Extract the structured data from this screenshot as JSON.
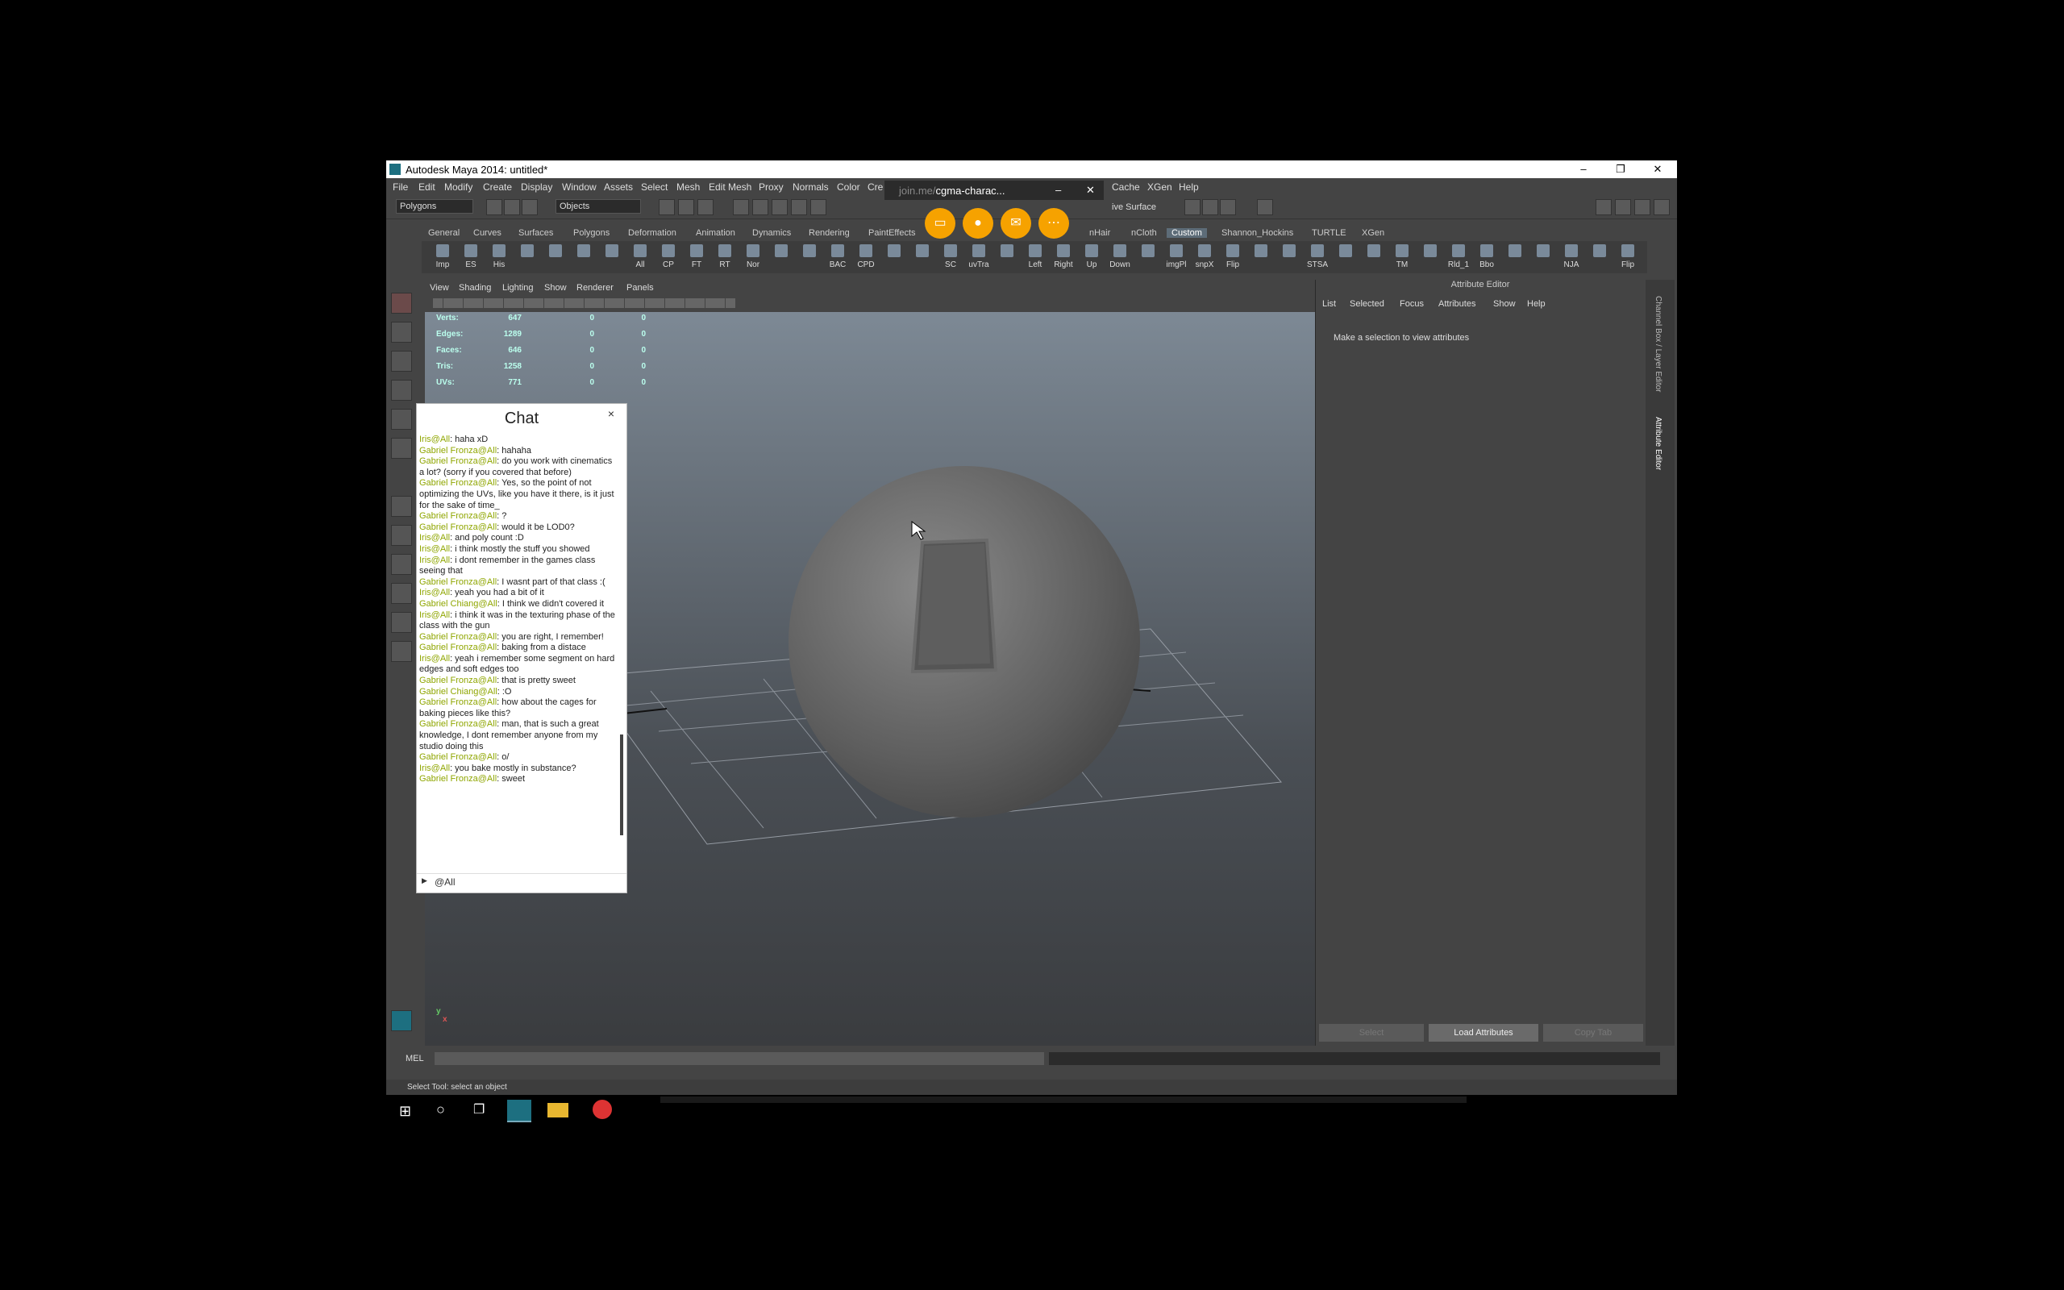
{
  "window": {
    "title": "Autodesk Maya 2014: untitled*",
    "minimize": "–",
    "maximize": "❐",
    "close": "✕"
  },
  "menubar": [
    "File",
    "Edit",
    "Modify",
    "Create",
    "Display",
    "Window",
    "Assets",
    "Select",
    "Mesh",
    "Edit Mesh",
    "Proxy",
    "Normals",
    "Color",
    "Cre",
    "Cache",
    "XGen",
    "Help"
  ],
  "statusline": {
    "menuset": "Polygons",
    "selmode": "Objects",
    "live": "ive Surface"
  },
  "shelf_tabs": [
    "General",
    "Curves",
    "Surfaces",
    "Polygons",
    "Deformation",
    "Animation",
    "Dynamics",
    "Rendering",
    "PaintEffects",
    "nHair",
    "nCloth",
    "Custom",
    "Shannon_Hockins",
    "TURTLE",
    "XGen"
  ],
  "shelf_active": "Custom",
  "shelf_labels": [
    "Imp",
    "ES",
    "His",
    "",
    "",
    "",
    "",
    "All",
    "CP",
    "FT",
    "RT",
    "Nor",
    "",
    "",
    "BAC",
    "CPD",
    "",
    "",
    "SC",
    "uvTra",
    "",
    "Left",
    "Right",
    "Up",
    "Down",
    "",
    "imgPl",
    "snpX",
    "Flip",
    "",
    "",
    "STSA",
    "",
    "",
    "TM",
    "",
    "Rld_1",
    "Bbo",
    "",
    "",
    "NJA",
    "",
    "Flip"
  ],
  "viewport": {
    "menus": [
      "View",
      "Shading",
      "Lighting",
      "Show",
      "Renderer",
      "Panels"
    ],
    "hud": [
      {
        "label": "Verts:",
        "v": [
          "647",
          "0",
          "0"
        ]
      },
      {
        "label": "Edges:",
        "v": [
          "1289",
          "0",
          "0"
        ]
      },
      {
        "label": "Faces:",
        "v": [
          "646",
          "0",
          "0"
        ]
      },
      {
        "label": "Tris:",
        "v": [
          "1258",
          "0",
          "0"
        ]
      },
      {
        "label": "UVs:",
        "v": [
          "771",
          "0",
          "0"
        ]
      }
    ],
    "axis_y": "y",
    "axis_x": "x"
  },
  "attribute_editor": {
    "title": "Attribute Editor",
    "menus": [
      "List",
      "Selected",
      "Focus",
      "Attributes",
      "Show",
      "Help"
    ],
    "message": "Make a selection to view attributes",
    "buttons": [
      "Select",
      "Load Attributes",
      "Copy Tab"
    ],
    "side_tabs": [
      "Channel Box / Layer Editor",
      "Attribute Editor"
    ]
  },
  "command_line": {
    "label": "MEL"
  },
  "help_line": "Select Tool: select an object",
  "chat": {
    "title": "Chat",
    "close": "×",
    "footer": "@All",
    "messages": [
      {
        "n": "Iris@All",
        "t": ": haha xD"
      },
      {
        "n": "Gabriel Fronza@All",
        "t": ": hahaha"
      },
      {
        "n": "Gabriel Fronza@All",
        "t": ": do you work with cinematics a lot? (sorry if you covered that before)"
      },
      {
        "n": "Gabriel Fronza@All",
        "t": ": Yes, so the point of not optimizing the UVs, like you have it there, is it just for the sake of time_"
      },
      {
        "n": "Gabriel Fronza@All",
        "t": ": ?"
      },
      {
        "n": "Gabriel Fronza@All",
        "t": ": would it be LOD0?"
      },
      {
        "n": "Iris@All",
        "t": ": and poly count :D"
      },
      {
        "n": "Iris@All",
        "t": ": i think mostly the stuff you showed"
      },
      {
        "n": "Iris@All",
        "t": ": i dont remember in the games class seeing that"
      },
      {
        "n": "Gabriel Fronza@All",
        "t": ": I wasnt part of that class :("
      },
      {
        "n": "Iris@All",
        "t": ": yeah you had a bit of it"
      },
      {
        "n": "Gabriel Chiang@All",
        "t": ": I think we didn't covered it"
      },
      {
        "n": "Iris@All",
        "t": ": i think it was in the texturing phase of the class with the gun"
      },
      {
        "n": "Gabriel Fronza@All",
        "t": ": you are right, I remember!"
      },
      {
        "n": "Gabriel Fronza@All",
        "t": ": baking from a distace"
      },
      {
        "n": "Iris@All",
        "t": ": yeah i remember some segment on hard edges and soft edges too"
      },
      {
        "n": "Gabriel Fronza@All",
        "t": ": that is pretty sweet"
      },
      {
        "n": "Gabriel Chiang@All",
        "t": ": :O"
      },
      {
        "n": "Gabriel Fronza@All",
        "t": ": how about the cages for baking pieces like this?"
      },
      {
        "n": "Gabriel Fronza@All",
        "t": ": man, that is such a great knowledge, I dont remember anyone from my studio doing this"
      },
      {
        "n": "Gabriel Fronza@All",
        "t": ": o/"
      },
      {
        "n": "Iris@All",
        "t": ": you bake mostly in substance?"
      },
      {
        "n": "Gabriel Fronza@All",
        "t": ": sweet"
      }
    ]
  },
  "meeting": {
    "url": "join.me/cgma-charac...",
    "url_prefix": "join.me/",
    "url_rest": "cgma-charac...",
    "close": "✕",
    "minimize": "–"
  },
  "colors": {
    "accent_orange": "#f6a200",
    "chat_name": "#8fa600",
    "maya_bg": "#444444"
  }
}
